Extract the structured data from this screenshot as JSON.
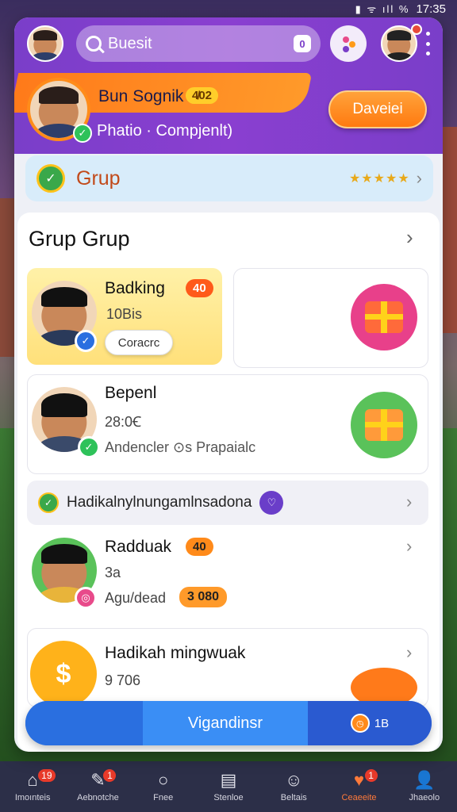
{
  "status_bar": {
    "icons": "▮ ᯤ ıll %",
    "time": "17:35"
  },
  "header": {
    "search_placeholder": "Buesit",
    "user": {
      "name": "Bun Sognik",
      "level": "4̸02",
      "subtitle": "Phatio · Compjenlt)"
    },
    "detail_button": "Daveiei"
  },
  "grup_banner": {
    "label": "Grup",
    "rating": "★★★★★"
  },
  "panel": {
    "title": "Grup Grup",
    "featured": {
      "name": "Badking",
      "badge": "40",
      "sub": "10Bis",
      "contact_label": "Coracrc"
    },
    "items": [
      {
        "name": "Bepenl",
        "sub": "28:0Ꞓ",
        "desc": "Andencler  ⊙s Prapaialc"
      },
      {
        "name": "Radduak",
        "badge": "40",
        "sub": "3a",
        "desc": "Agu/dead",
        "amount": "3 080"
      },
      {
        "name": "Hadikah mingwuak",
        "sub": "9 706"
      }
    ],
    "challenge": {
      "text": "Hadikalnylnungamlnsadona"
    }
  },
  "bottom_action": {
    "label": "Vigandinsr",
    "count": "1B"
  },
  "nav": [
    {
      "label": "Imoınteis",
      "badge": "19",
      "icon": "home-icon"
    },
    {
      "label": "Aebnotche",
      "badge": "1",
      "icon": "edit-icon"
    },
    {
      "label": "Fnee",
      "badge": "",
      "icon": "circle-icon"
    },
    {
      "label": "Stenloe",
      "badge": "",
      "icon": "document-icon"
    },
    {
      "label": "Beltais",
      "badge": "",
      "icon": "group-icon"
    },
    {
      "label": "Ceaeeite",
      "badge": "1",
      "icon": "heart-icon"
    },
    {
      "label": "Jhaeolo",
      "badge": "",
      "icon": "person-icon"
    }
  ],
  "colors": {
    "header": "#7a3ec9",
    "accent_orange": "#ff7a1a",
    "bottom_bar": "#2a6fe0",
    "nav_bg": "#2c2f48"
  }
}
